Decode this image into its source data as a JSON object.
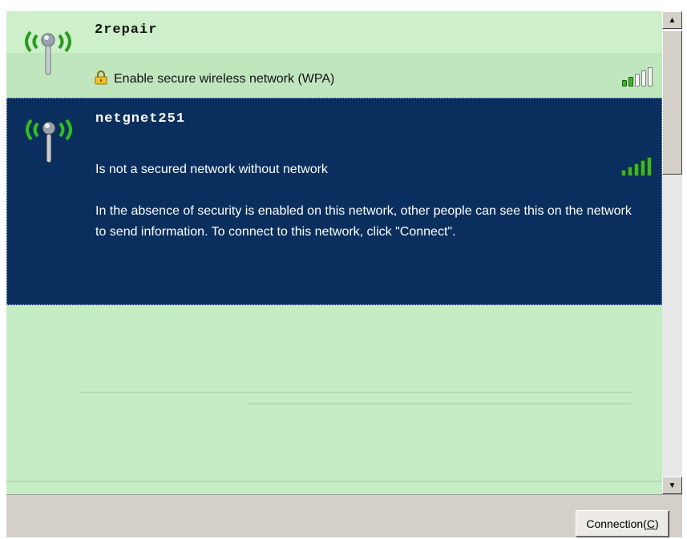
{
  "networks": [
    {
      "ssid": "2repair",
      "status": "Enable secure wireless network (WPA)",
      "secured": true,
      "selected": false,
      "signal_bars_filled": 2,
      "signal_bars_total": 5,
      "icon": "wireless-antenna-icon"
    },
    {
      "ssid": "netgnet251",
      "status": "Is not a secured network without network",
      "description": "In the absence of security is enabled on this network, other people can see this on the network to send information. To connect to this network, click \"Connect\".",
      "secured": false,
      "selected": true,
      "signal_bars_filled": 5,
      "signal_bars_total": 5,
      "icon": "wireless-antenna-icon"
    }
  ],
  "scrollbar": {
    "up": "▲",
    "down": "▼"
  },
  "footer": {
    "connect_label": "Connection",
    "connect_accel": "C"
  },
  "colors": {
    "list_background": "#c6ecc5",
    "selected_background": "#0a2f5e",
    "signal_green": "#3cb52c"
  }
}
